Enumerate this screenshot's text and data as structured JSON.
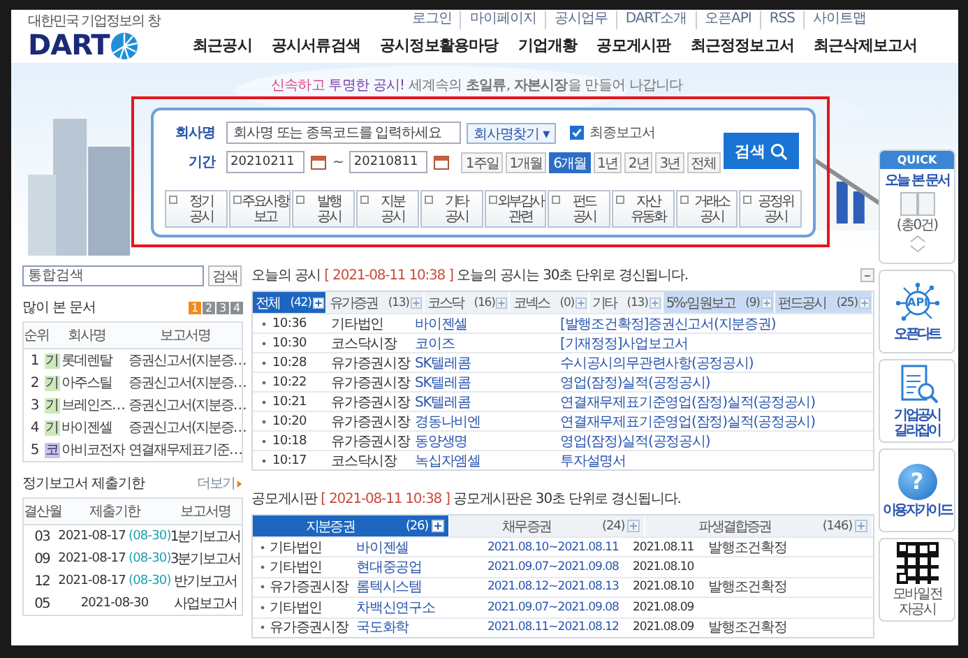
{
  "top_links": [
    "로그인",
    "마이페이지",
    "공시업무",
    "DART소개",
    "오픈API",
    "RSS",
    "사이트맵"
  ],
  "logo": {
    "tagline": "대한민국 기업정보의 창",
    "name": "DART"
  },
  "main_nav": [
    "최근공시",
    "공시서류검색",
    "공시정보활용마당",
    "기업개황",
    "공모게시판",
    "최근정정보고서",
    "최근삭제보고서"
  ],
  "banner": {
    "kind": "picture",
    "slogan": [
      {
        "text": "신속하고",
        "color": "#e0408a"
      },
      {
        "text": "투명한 공시!",
        "color": "#7a3fa8"
      },
      {
        "text": "세계속의 **초일류**, **자본시장**을 만들어 나갑니다",
        "color": "#777777"
      }
    ]
  },
  "search_panel": {
    "highlighted": true,
    "company_label": "회사명",
    "company_placeholder": "회사명 또는 종목코드를 입력하세요",
    "find_button": "회사명찾기 ▾",
    "final_report": {
      "label": "최종보고서",
      "checked": true
    },
    "period_label": "기간",
    "date_from": "20210211",
    "date_separator": "~",
    "date_to": "20210811",
    "periods": [
      {
        "label": "1주일",
        "selected": false
      },
      {
        "label": "1개월",
        "selected": false
      },
      {
        "label": "6개월",
        "selected": true
      },
      {
        "label": "1년",
        "selected": false
      },
      {
        "label": "2년",
        "selected": false
      },
      {
        "label": "3년",
        "selected": false
      },
      {
        "label": "전체",
        "selected": false
      }
    ],
    "search_button": "검색",
    "categories": [
      {
        "label": "정기\n공시",
        "checked": false
      },
      {
        "label": "주요사항\n보고",
        "checked": false
      },
      {
        "label": "발행\n공시",
        "checked": false
      },
      {
        "label": "지분\n공시",
        "checked": false
      },
      {
        "label": "기타\n공시",
        "checked": false
      },
      {
        "label": "외부감사\n관련",
        "checked": false
      },
      {
        "label": "펀드\n공시",
        "checked": false
      },
      {
        "label": "자산\n유동화",
        "checked": false
      },
      {
        "label": "거래소\n공시",
        "checked": false
      },
      {
        "label": "공정위\n공시",
        "checked": false
      }
    ]
  },
  "integrated_search": {
    "placeholder": "통합검색",
    "button": "검색"
  },
  "popular_docs": {
    "title": "많이 본 문서",
    "pages": [
      {
        "label": "1",
        "selected": true
      },
      {
        "label": "2",
        "selected": false
      },
      {
        "label": "3",
        "selected": false
      },
      {
        "label": "4",
        "selected": false
      }
    ],
    "columns": [
      "순위",
      "회사명",
      "보고서명"
    ],
    "rows": [
      {
        "rank": "1",
        "market": "기",
        "color": "#cfe8b8",
        "company": "롯데렌탈",
        "report": "증권신고서(지분증…"
      },
      {
        "rank": "2",
        "market": "기",
        "color": "#cfe8b8",
        "company": "아주스틸",
        "report": "증권신고서(지분증…"
      },
      {
        "rank": "3",
        "market": "기",
        "color": "#cfe8b8",
        "company": "브레인즈…",
        "report": "증권신고서(지분증…"
      },
      {
        "rank": "4",
        "market": "기",
        "color": "#cfe8b8",
        "company": "바이젠셀",
        "report": "증권신고서(지분증…"
      },
      {
        "rank": "5",
        "market": "코",
        "color": "#c8c4ef",
        "company": "아비코전자",
        "report": "연결재무제표기준…"
      }
    ]
  },
  "filing_deadlines": {
    "title": "정기보고서 제출기한",
    "more": "더보기",
    "columns": [
      "결산월",
      "제출기한",
      "보고서명"
    ],
    "rows": [
      {
        "month": "03",
        "deadline": "2021-08-17",
        "extended": "(08-30)",
        "report": "1분기보고서"
      },
      {
        "month": "09",
        "deadline": "2021-08-17",
        "extended": "(08-30)",
        "report": "3분기보고서"
      },
      {
        "month": "12",
        "deadline": "2021-08-17",
        "extended": "(08-30)",
        "report": "반기보고서"
      },
      {
        "month": "05",
        "deadline": "2021-08-30",
        "report": "사업보고서"
      }
    ]
  },
  "today": {
    "title": "오늘의 공시",
    "timestamp": "[ 2021-08-11 10:38 ]",
    "note": "오늘의 공시는 30초 단위로 경신됩니다.",
    "tabs": [
      {
        "label": "전체",
        "count": "(42)",
        "selected": true,
        "kind": "main"
      },
      {
        "label": "유가증권",
        "count": "(13)",
        "selected": false,
        "kind": "main"
      },
      {
        "label": "코스닥",
        "count": "(16)",
        "selected": false,
        "kind": "main"
      },
      {
        "label": "코넥스",
        "count": "(0)",
        "selected": false,
        "kind": "main"
      },
      {
        "label": "기타",
        "count": "(13)",
        "selected": false,
        "kind": "main"
      },
      {
        "label": "5%·임원보고",
        "count": "(9)",
        "selected": false,
        "kind": "extra"
      },
      {
        "label": "펀드공시",
        "count": "(25)",
        "selected": false,
        "kind": "extra"
      }
    ],
    "rows": [
      {
        "time": "10:36",
        "market": "기타법인",
        "company": "바이젠셀",
        "report": "[발행조건확정]증권신고서(지분증권)"
      },
      {
        "time": "10:30",
        "market": "코스닥시장",
        "company": "코이즈",
        "report": "[기재정정]사업보고서"
      },
      {
        "time": "10:28",
        "market": "유가증권시장",
        "company": "SK텔레콤",
        "report": "수시공시의무관련사항(공정공시)"
      },
      {
        "time": "10:22",
        "market": "유가증권시장",
        "company": "SK텔레콤",
        "report": "영업(잠정)실적(공정공시)"
      },
      {
        "time": "10:21",
        "market": "유가증권시장",
        "company": "SK텔레콤",
        "report": "연결재무제표기준영업(잠정)실적(공정공시)"
      },
      {
        "time": "10:20",
        "market": "유가증권시장",
        "company": "경동나비엔",
        "report": "연결재무제표기준영업(잠정)실적(공정공시)"
      },
      {
        "time": "10:18",
        "market": "유가증권시장",
        "company": "동양생명",
        "report": "영업(잠정)실적(공정공시)"
      },
      {
        "time": "10:17",
        "market": "코스닥시장",
        "company": "녹십자엠셀",
        "report": "투자설명서"
      }
    ]
  },
  "offering": {
    "title": "공모게시판",
    "timestamp": "[ 2021-08-11 10:38 ]",
    "note": "공모게시판은 30초 단위로 경신됩니다.",
    "tabs": [
      {
        "label": "지분증권",
        "count": "(26)",
        "selected": true
      },
      {
        "label": "채무증권",
        "count": "(24)",
        "selected": false
      },
      {
        "label": "파생결합증권",
        "count": "(146)",
        "selected": false
      }
    ],
    "rows": [
      {
        "market": "기타법인",
        "company": "바이젠셀",
        "period": "2021.08.10~2021.08.11",
        "date": "2021.08.11",
        "note": "발행조건확정"
      },
      {
        "market": "기타법인",
        "company": "현대중공업",
        "period": "2021.09.07~2021.09.08",
        "date": "2021.08.10"
      },
      {
        "market": "유가증권시장",
        "company": "롬텍시스템",
        "period": "2021.08.12~2021.08.13",
        "date": "2021.08.10",
        "note": "발행조건확정"
      },
      {
        "market": "기타법인",
        "company": "차백신연구소",
        "period": "2021.09.07~2021.09.08",
        "date": "2021.08.09"
      },
      {
        "market": "유가증권시장",
        "company": "국도화학",
        "period": "2021.08.11~2021.08.12",
        "date": "2021.08.09",
        "note": "발행조건확정"
      }
    ]
  },
  "quick": {
    "title": "QUICK",
    "today_docs": "오늘 본 문서",
    "count": "(총0건)",
    "links": [
      {
        "kind": "api",
        "label": "오픈다트",
        "icon_text": "API"
      },
      {
        "kind": "guide",
        "label": "기업공시\n길라잡이"
      },
      {
        "kind": "help",
        "label": "이용자가이드",
        "icon_text": "?"
      },
      {
        "kind": "qr",
        "label": "모바일전자공시"
      }
    ]
  }
}
